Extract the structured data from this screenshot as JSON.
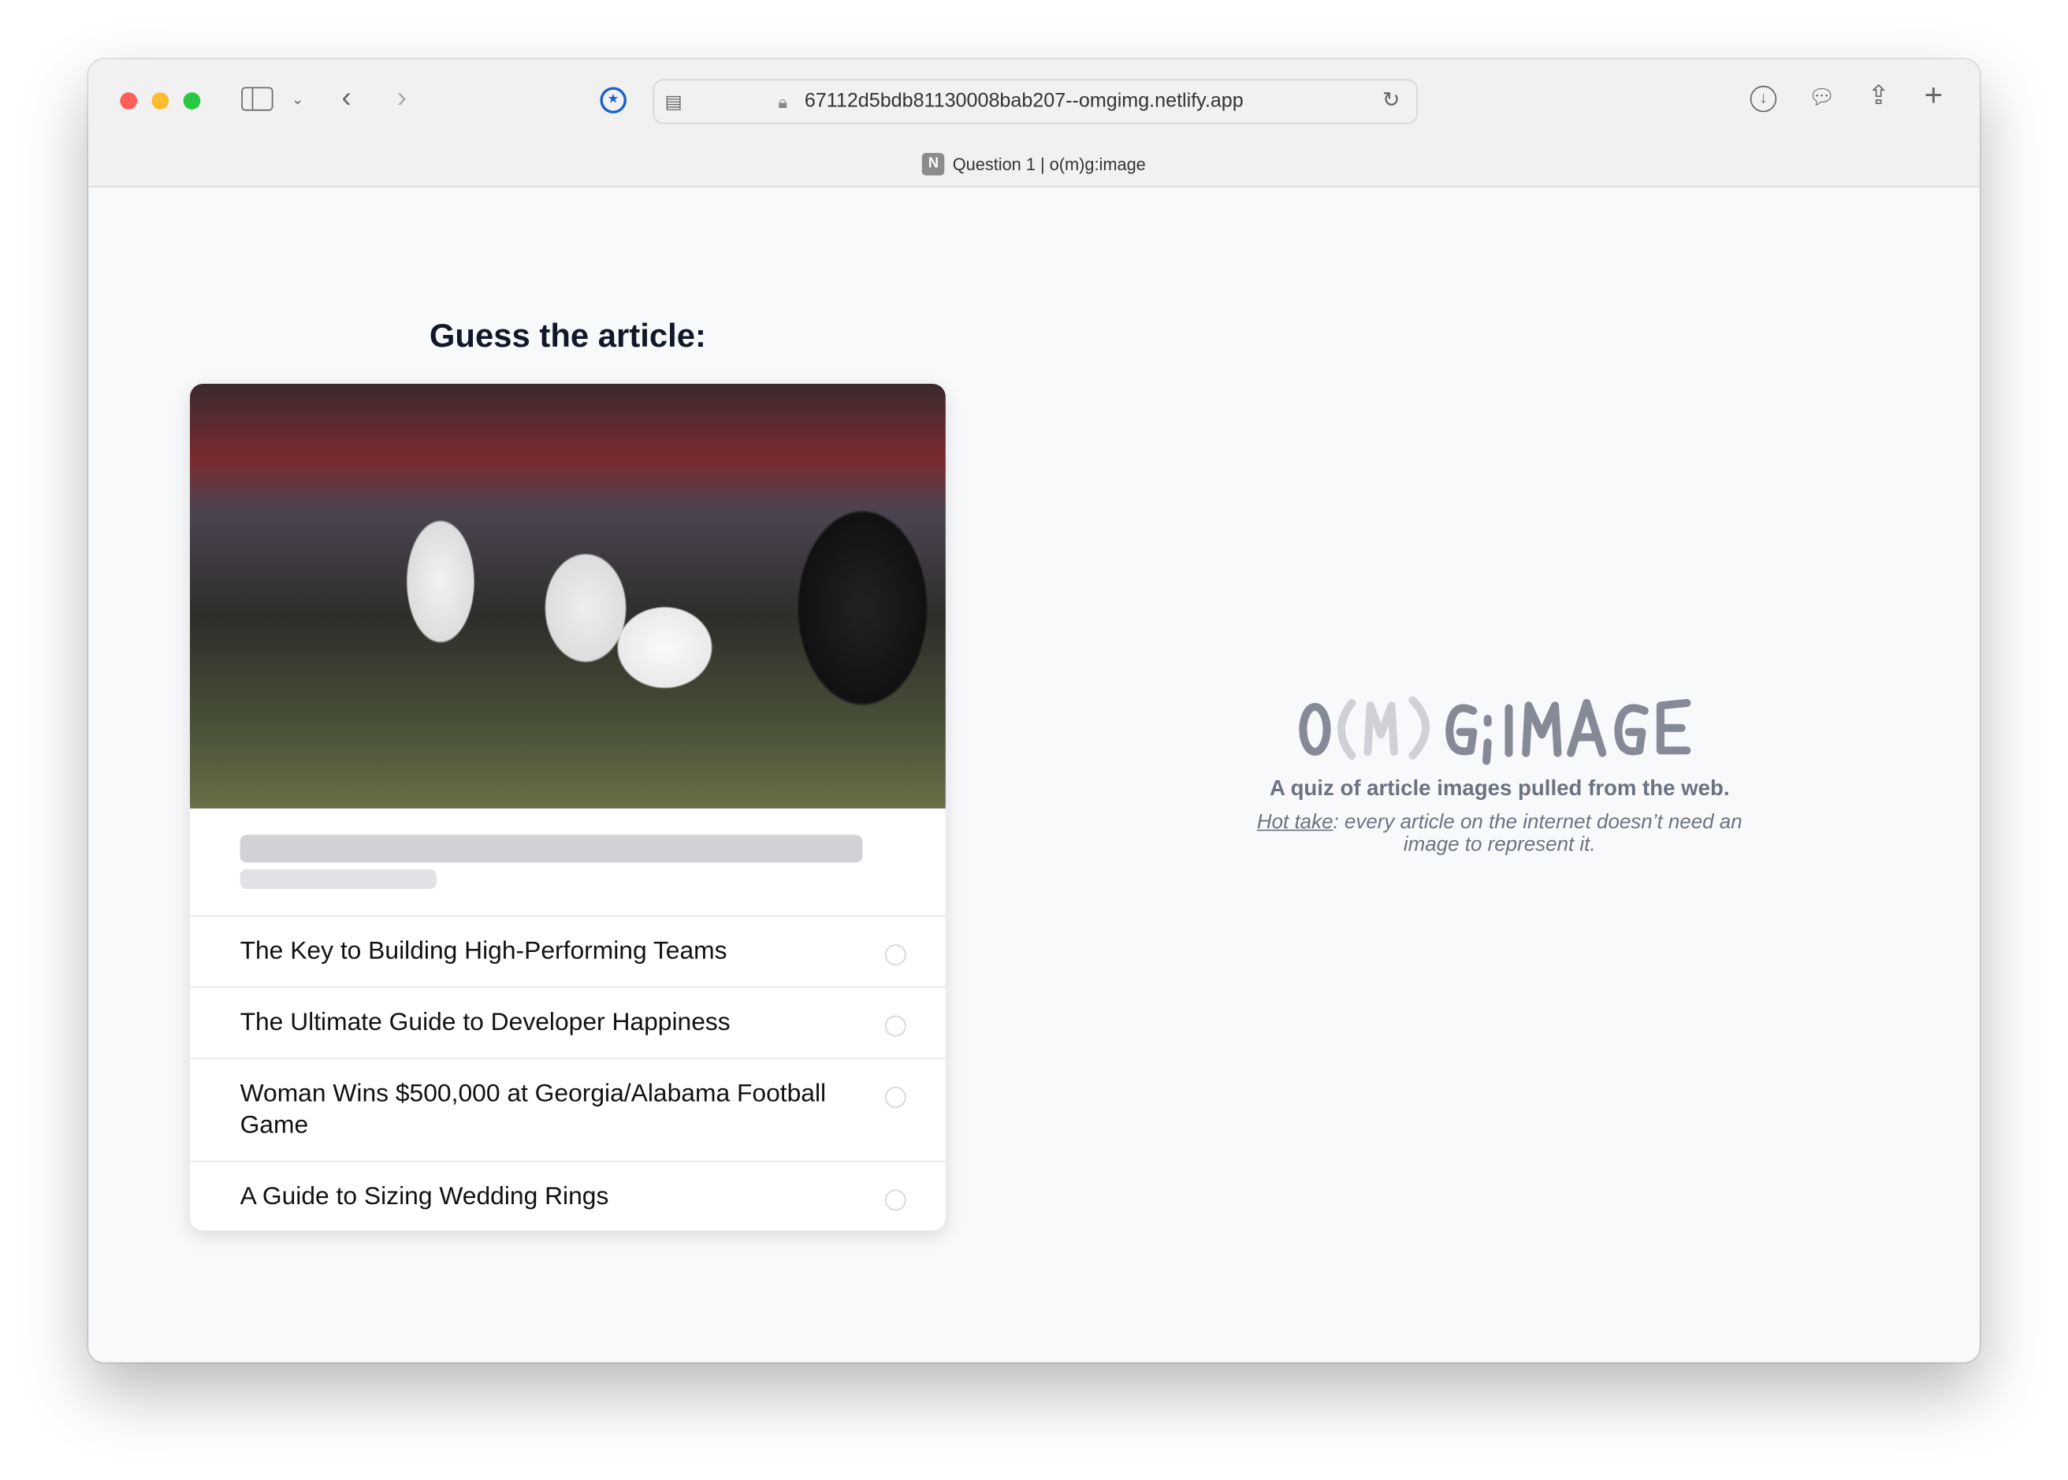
{
  "browser": {
    "url": "67112d5bdb81130008bab207--omgimg.netlify.app",
    "tab_title": "Question 1 | o(m)g:image",
    "tab_favicon": "N",
    "traffic_lights": [
      "#ff5f57",
      "#febc2e",
      "#28c840"
    ]
  },
  "quiz": {
    "heading": "Guess the article:",
    "options": [
      {
        "label": "The Key to Building High-Performing Teams"
      },
      {
        "label": "The Ultimate Guide to Developer Happiness"
      },
      {
        "label": "Woman Wins $500,000 at Georgia/Alabama Football Game"
      },
      {
        "label": "A Guide to Sizing Wedding Rings"
      }
    ]
  },
  "branding": {
    "logo_text": "O(M)G:IMAGE",
    "tagline": "A quiz of article images pulled from the web.",
    "hot_take_link": "Hot take",
    "hot_take_text": ": every article on the internet doesn’t need an image to represent it."
  }
}
